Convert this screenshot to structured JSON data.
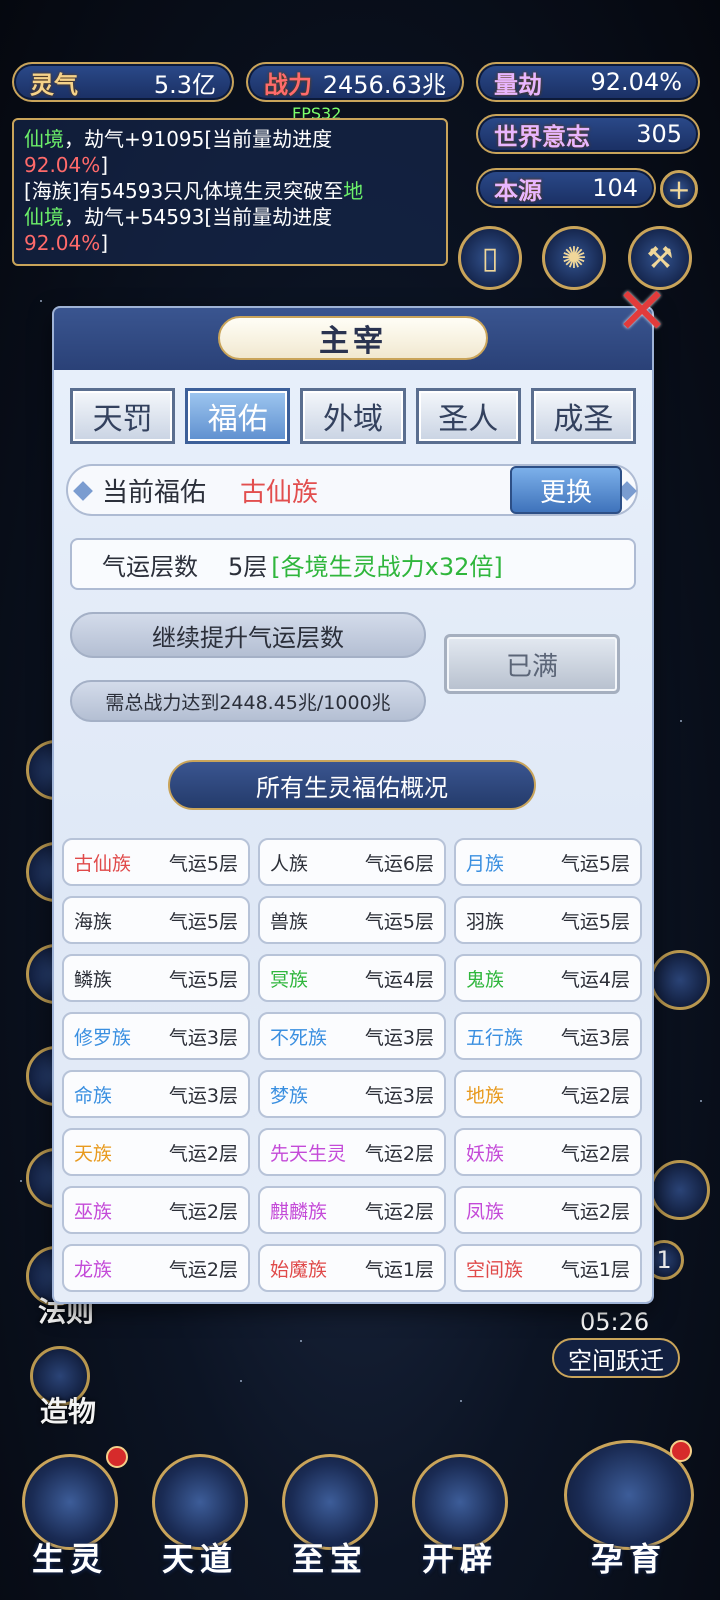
{
  "stats": {
    "lingqi_label": "灵气",
    "lingqi_value": "5.3亿",
    "power_label": "战力",
    "power_value": "2456.63兆",
    "liangjie_label": "量劫",
    "liangjie_value": "92.04%",
    "world_will_label": "世界意志",
    "world_will_value": "305",
    "origin_label": "本源",
    "origin_value": "104"
  },
  "fps": "FPS32",
  "log": {
    "line1_a": "仙境",
    "line1_b": "，劫气+91095[当前量劫进度",
    "line1_c": "92.04%",
    "line1_d": "]",
    "line2_a": "[海族]有54593只凡体境生灵突破至",
    "line2_b": "地",
    "line2_c": "仙境",
    "line2_d": "，劫气+54593[当前量劫进度",
    "line2_e": "92.04%",
    "line2_f": "]"
  },
  "modal": {
    "title": "主宰",
    "tabs": [
      "天罚",
      "福佑",
      "外域",
      "圣人",
      "成圣"
    ],
    "active_tab": 1,
    "current_label": "当前福佑",
    "current_value": "古仙族",
    "swap_label": "更换",
    "luck_label": "气运层数",
    "luck_level": "5层",
    "luck_bonus": "[各境生灵战力x32倍]",
    "upgrade_label": "继续提升气运层数",
    "requirement": "需总战力达到2448.45兆/1000兆",
    "full_label": "已满",
    "section_title": "所有生灵福佑概况"
  },
  "races": [
    {
      "name": "古仙族",
      "level": "气运5层",
      "color": "#e04a4a"
    },
    {
      "name": "人族",
      "level": "气运6层",
      "color": "#2c2f38"
    },
    {
      "name": "月族",
      "level": "气运5层",
      "color": "#3a8fe0"
    },
    {
      "name": "海族",
      "level": "气运5层",
      "color": "#2c2f38"
    },
    {
      "name": "兽族",
      "level": "气运5层",
      "color": "#2c2f38"
    },
    {
      "name": "羽族",
      "level": "气运5层",
      "color": "#2c2f38"
    },
    {
      "name": "鳞族",
      "level": "气运5层",
      "color": "#2c2f38"
    },
    {
      "name": "冥族",
      "level": "气运4层",
      "color": "#2fb63c"
    },
    {
      "name": "鬼族",
      "level": "气运4层",
      "color": "#2fb63c"
    },
    {
      "name": "修罗族",
      "level": "气运3层",
      "color": "#3a8fe0"
    },
    {
      "name": "不死族",
      "level": "气运3层",
      "color": "#3a8fe0"
    },
    {
      "name": "五行族",
      "level": "气运3层",
      "color": "#3a8fe0"
    },
    {
      "name": "命族",
      "level": "气运3层",
      "color": "#3a8fe0"
    },
    {
      "name": "梦族",
      "level": "气运3层",
      "color": "#3a8fe0"
    },
    {
      "name": "地族",
      "level": "气运2层",
      "color": "#e89a1e"
    },
    {
      "name": "天族",
      "level": "气运2层",
      "color": "#e89a1e"
    },
    {
      "name": "先天生灵",
      "level": "气运2层",
      "color": "#c44ad8"
    },
    {
      "name": "妖族",
      "level": "气运2层",
      "color": "#c44ad8"
    },
    {
      "name": "巫族",
      "level": "气运2层",
      "color": "#c44ad8"
    },
    {
      "name": "麒麟族",
      "level": "气运2层",
      "color": "#c44ad8"
    },
    {
      "name": "凤族",
      "level": "气运2层",
      "color": "#c44ad8"
    },
    {
      "name": "龙族",
      "level": "气运2层",
      "color": "#c44ad8"
    },
    {
      "name": "始魔族",
      "level": "气运1层",
      "color": "#e04a4a"
    },
    {
      "name": "空间族",
      "level": "气运1层",
      "color": "#e04a4a"
    }
  ],
  "side": {
    "faze": "法则",
    "zaowu": "造物",
    "timer": "05:26",
    "space_jump": "空间跃迁",
    "badge_num": "1"
  },
  "bottom_nav": [
    "生灵",
    "天道",
    "至宝",
    "开辟",
    "孕育"
  ]
}
